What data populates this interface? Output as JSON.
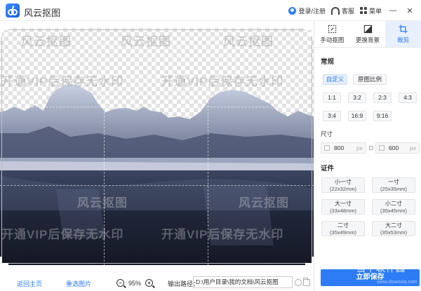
{
  "app": {
    "title": "风云抠图"
  },
  "titlebar": {
    "login": "登录/注册",
    "service": "客服",
    "menu": "菜单",
    "minimize": "—",
    "close": "✕"
  },
  "watermark": "开通VIP后保存无水印",
  "watermark_short": "风云抠图",
  "bottom": {
    "back_home": "返回主页",
    "reselect": "重选图片",
    "zoom": "95%",
    "output_label": "输出路径：",
    "output_path": "D:\\用户目录\\我的文档\\风云抠图"
  },
  "panel": {
    "tools": [
      {
        "label": "手动抠图",
        "icon": "manual-cutout-icon"
      },
      {
        "label": "更换背景",
        "icon": "change-background-icon"
      },
      {
        "label": "裁剪",
        "icon": "crop-icon"
      }
    ],
    "section_general": "常规",
    "ratio_custom": "自定义",
    "ratio_original": "原图比例",
    "ratios": [
      "1:1",
      "3:2",
      "2:3",
      "4:3",
      "3:4",
      "16:9",
      "9:16"
    ],
    "size_label": "尺寸",
    "width": "800",
    "height": "600",
    "unit": "px",
    "section_id": "证件",
    "id_sizes": [
      {
        "name": "小一寸",
        "dim": "(22x32mm)"
      },
      {
        "name": "一寸",
        "dim": "(25x35mm)"
      },
      {
        "name": "大一寸",
        "dim": "(33x48mm)"
      },
      {
        "name": "小二寸",
        "dim": "(35x45mm)"
      },
      {
        "name": "二寸",
        "dim": "(35x49mm)"
      },
      {
        "name": "大二寸",
        "dim": "(35x53mm)"
      }
    ],
    "save": "立即保存",
    "site_logo": "当下软件园",
    "site_url": "www.downxia.com"
  },
  "colors": {
    "accent": "#2d7cf6",
    "active_bg": "#e8f0fd"
  }
}
